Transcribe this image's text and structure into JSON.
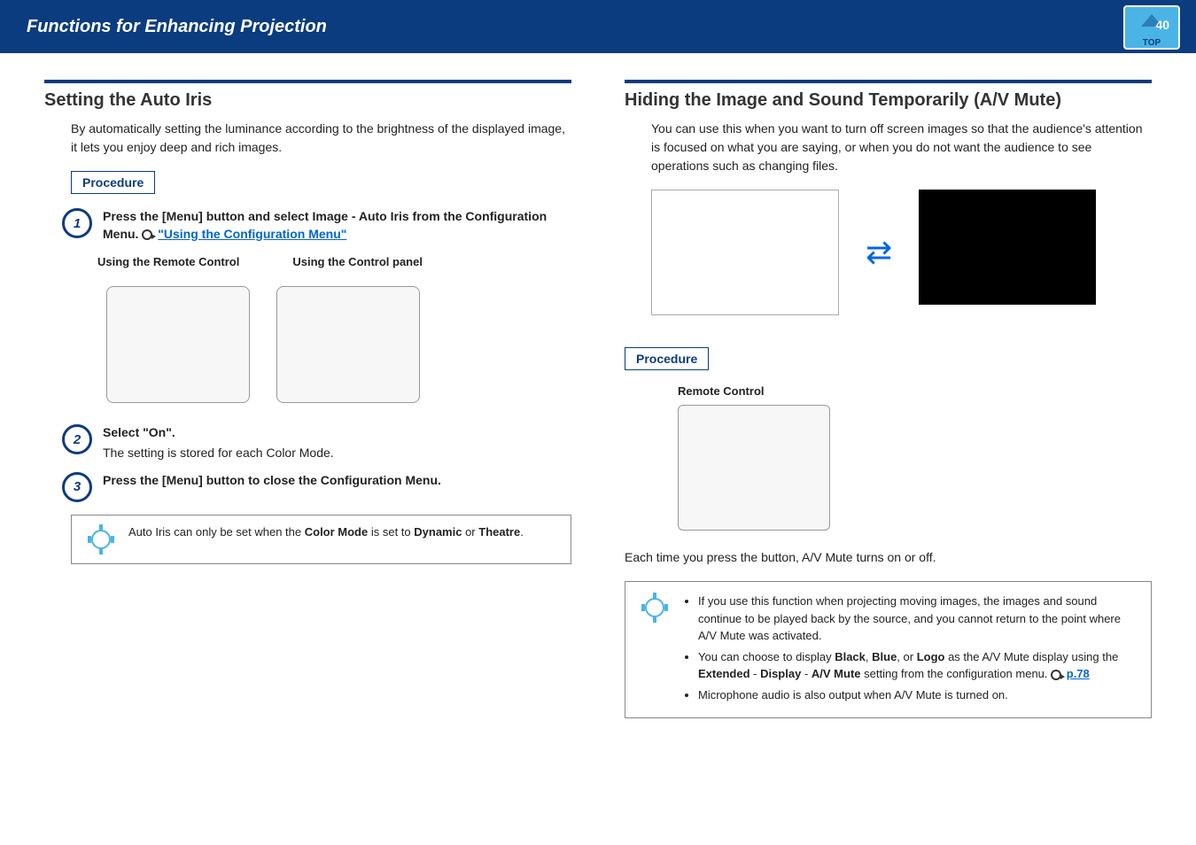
{
  "header": {
    "title": "Functions for Enhancing Projection",
    "badge": "TOP",
    "page": "40"
  },
  "left": {
    "section_title": "Setting the Auto Iris",
    "intro": "By automatically setting the luminance according to the brightness of the displayed image, it lets you enjoy deep and rich images.",
    "procedure_label": "Procedure",
    "step1_a": "Press the [Menu] button and select Image - Auto Iris from the Configuration Menu. ",
    "step1_link": "\"Using the Configuration Menu\"",
    "cap_remote": "Using the Remote Control",
    "cap_panel": "Using the Control panel",
    "step2_bold": "Select \"On\".",
    "step2_text": "The setting is stored for each Color Mode.",
    "step3_text": "Press the [Menu] button to close the Configuration Menu.",
    "tip_pre": "Auto Iris can only be set when the ",
    "tip_cm": "Color Mode",
    "tip_mid": " is set to ",
    "tip_dyn": "Dynamic",
    "tip_or": " or ",
    "tip_th": "Theatre",
    "tip_end": "."
  },
  "right": {
    "section_title": "Hiding the Image and Sound Temporarily (A/V Mute)",
    "intro": "You can use this when you want to turn off screen images so that the audience's attention is focused on what you are saying, or when you do not want the audience to see operations such as changing files.",
    "procedure_label": "Procedure",
    "cap_remote": "Remote Control",
    "body": "Each time you press the button, A/V Mute turns on or off.",
    "note1": "If you use this function when projecting moving images, the images and sound continue to be played back by the source, and you cannot return to the point where A/V Mute was activated.",
    "note2_a": "You can choose to display ",
    "note2_b": "Black",
    "note2_c": ", ",
    "note2_d": "Blue",
    "note2_e": ", or ",
    "note2_f": "Logo",
    "note2_g": " as the A/V Mute display using the ",
    "note2_h": "Extended",
    "note2_i": " - ",
    "note2_j": "Display",
    "note2_k": " - ",
    "note2_l": "A/V Mute",
    "note2_m": " setting from the configuration menu. ",
    "note2_link": "p.78",
    "note3": "Microphone audio is also output when A/V Mute is turned on."
  }
}
